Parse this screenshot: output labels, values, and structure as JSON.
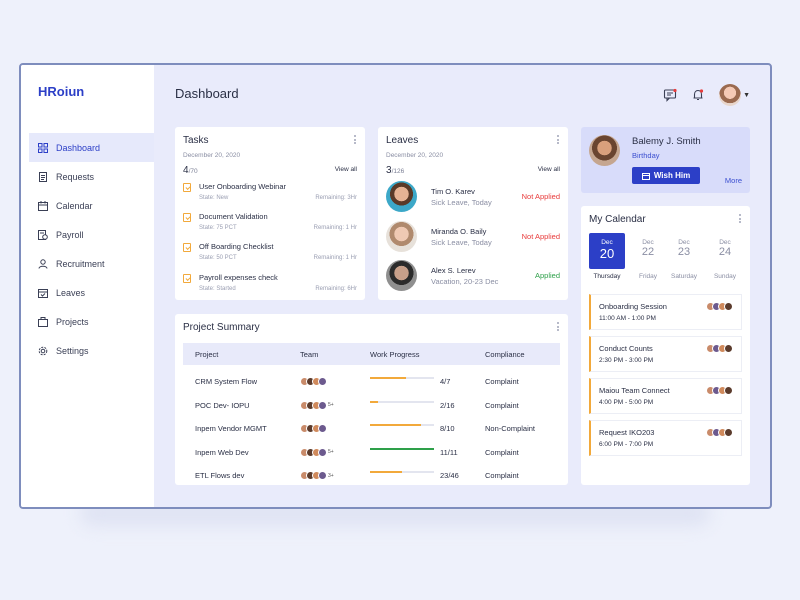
{
  "app": {
    "logo": "HRoiun"
  },
  "sidebar": {
    "items": [
      {
        "label": "Dashboard",
        "icon": "grid-icon",
        "active": true
      },
      {
        "label": "Requests",
        "icon": "document-icon"
      },
      {
        "label": "Calendar",
        "icon": "calendar-icon"
      },
      {
        "label": "Payroll",
        "icon": "payroll-icon"
      },
      {
        "label": "Recruitment",
        "icon": "person-icon"
      },
      {
        "label": "Leaves",
        "icon": "calendar-check-icon"
      },
      {
        "label": "Projects",
        "icon": "briefcase-icon"
      },
      {
        "label": "Settings",
        "icon": "gear-icon"
      }
    ]
  },
  "header": {
    "title": "Dashboard",
    "icons": [
      "message-icon",
      "bell-icon",
      "avatar",
      "chevron-down-icon"
    ]
  },
  "tasks": {
    "title": "Tasks",
    "date": "December 20, 2020",
    "count": "4",
    "total": "/70",
    "view_all": "View all",
    "items": [
      {
        "name": "User Onboarding Webinar",
        "state": "State: New",
        "remaining": "Remaining: 3Hr"
      },
      {
        "name": "Document Validation",
        "state": "State: 75 PCT",
        "remaining": "Remaining: 1 Hr"
      },
      {
        "name": "Off Boarding Checklist",
        "state": "State: 50 PCT",
        "remaining": "Remaining: 1 Hr"
      },
      {
        "name": "Payroll expenses check",
        "state": "State: Started",
        "remaining": "Remaining: 6Hr"
      }
    ]
  },
  "leaves": {
    "title": "Leaves",
    "date": "December 20, 2020",
    "count": "3",
    "total": "/126",
    "view_all": "View all",
    "items": [
      {
        "name": "Tim O. Karev",
        "detail": "Sick Leave, Today",
        "status": "Not Applied",
        "status_color": "#e83b3b"
      },
      {
        "name": "Miranda O. Baily",
        "detail": "Sick Leave, Today",
        "status": "Not Applied",
        "status_color": "#e83b3b"
      },
      {
        "name": "Alex S. Lerev",
        "detail": "Vacation, 20-23 Dec",
        "status": "Applied",
        "status_color": "#2ea04a"
      }
    ]
  },
  "project_summary": {
    "title": "Project Summary",
    "columns": [
      "Project",
      "Team",
      "Work Progress",
      "Compliance"
    ],
    "rows": [
      {
        "project": "CRM System Flow",
        "team_extra": "",
        "progress_fraction": 0.57,
        "progress_color": "#f2a93b",
        "progress": "4/7",
        "compliance": "Complaint"
      },
      {
        "project": "POC Dev- IOPU",
        "team_extra": "5+",
        "progress_fraction": 0.13,
        "progress_color": "#f2a93b",
        "progress": "2/16",
        "compliance": "Complaint"
      },
      {
        "project": "Inpem Vendor MGMT",
        "team_extra": "",
        "progress_fraction": 0.8,
        "progress_color": "#f2a93b",
        "progress": "8/10",
        "compliance": "Non-Complaint"
      },
      {
        "project": "Inpem Web Dev",
        "team_extra": "5+",
        "progress_fraction": 1.0,
        "progress_color": "#2ea04a",
        "progress": "11/11",
        "compliance": "Complaint"
      },
      {
        "project": "ETL  Flows dev",
        "team_extra": "3+",
        "progress_fraction": 0.5,
        "progress_color": "#f2a93b",
        "progress": "23/46",
        "compliance": "Complaint"
      }
    ]
  },
  "birthday": {
    "name": "Balemy J. Smith",
    "subtitle": "Birthday",
    "button": "Wish Him",
    "more": "More"
  },
  "calendar": {
    "title": "My Calendar",
    "days": [
      {
        "month": "Dec",
        "day": "20",
        "weekday": "Thursday",
        "selected": true
      },
      {
        "month": "Dec",
        "day": "22",
        "weekday": "Friday"
      },
      {
        "month": "Dec",
        "day": "23",
        "weekday": "Saturday"
      },
      {
        "month": "Dec",
        "day": "24",
        "weekday": "Sunday"
      }
    ],
    "events": [
      {
        "title": "Onboarding Session",
        "time": "11:00 AM - 1:00 PM"
      },
      {
        "title": "Conduct Counts",
        "time": "2:30 PM - 3:00 PM"
      },
      {
        "title": "Maiou Team Connect",
        "time": "4:00 PM - 5:00 PM"
      },
      {
        "title": "Request IKO203",
        "time": "6:00 PM - 7:00 PM"
      }
    ]
  },
  "colors": {
    "accent": "#2c3fc7",
    "warning": "#f2a93b",
    "danger": "#e83b3b",
    "success": "#2ea04a"
  }
}
